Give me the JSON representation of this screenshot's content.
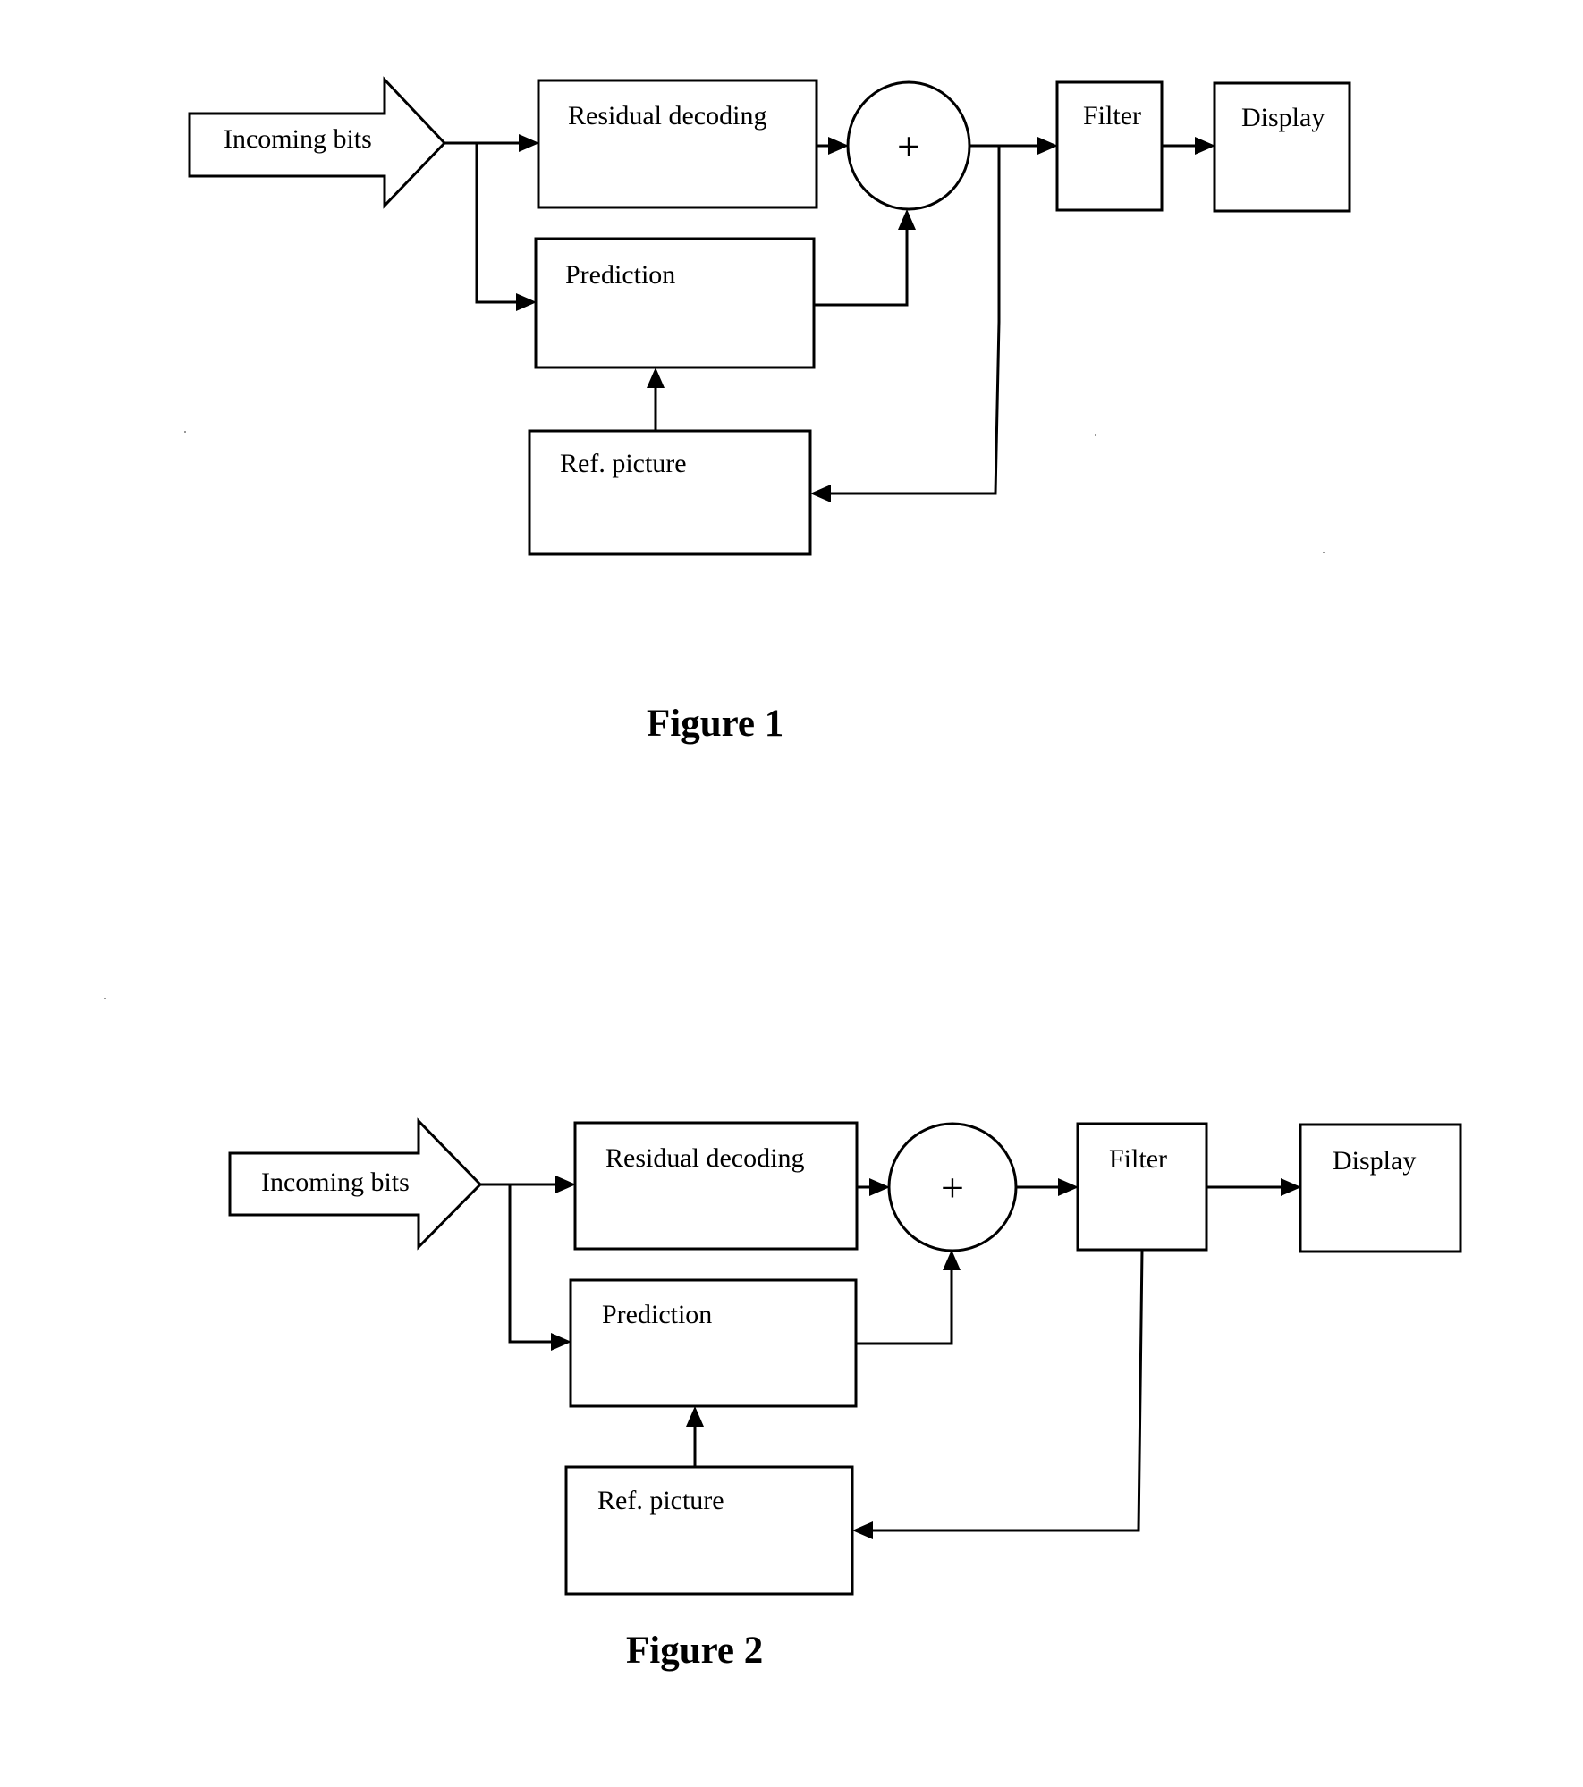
{
  "figures": [
    {
      "caption": "Figure 1",
      "variant": "filter-output-to-reference",
      "nodes": {
        "input": "Incoming bits",
        "residual": "Residual decoding",
        "prediction": "Prediction",
        "reference": "Ref. picture",
        "adder": "+",
        "filter": "Filter",
        "display": "Display"
      },
      "edges": [
        [
          "input",
          "residual"
        ],
        [
          "input",
          "prediction"
        ],
        [
          "residual",
          "adder"
        ],
        [
          "prediction",
          "adder"
        ],
        [
          "adder",
          "filter"
        ],
        [
          "adder",
          "reference"
        ],
        [
          "reference",
          "prediction"
        ],
        [
          "filter",
          "display"
        ]
      ]
    },
    {
      "caption": "Figure 2",
      "variant": "filter-output-to-reference",
      "nodes": {
        "input": "Incoming bits",
        "residual": "Residual decoding",
        "prediction": "Prediction",
        "reference": "Ref. picture",
        "adder": "+",
        "filter": "Filter",
        "display": "Display"
      },
      "edges": [
        [
          "input",
          "residual"
        ],
        [
          "input",
          "prediction"
        ],
        [
          "residual",
          "adder"
        ],
        [
          "prediction",
          "adder"
        ],
        [
          "adder",
          "filter"
        ],
        [
          "filter",
          "display"
        ],
        [
          "filter",
          "reference"
        ],
        [
          "reference",
          "prediction"
        ]
      ]
    }
  ]
}
